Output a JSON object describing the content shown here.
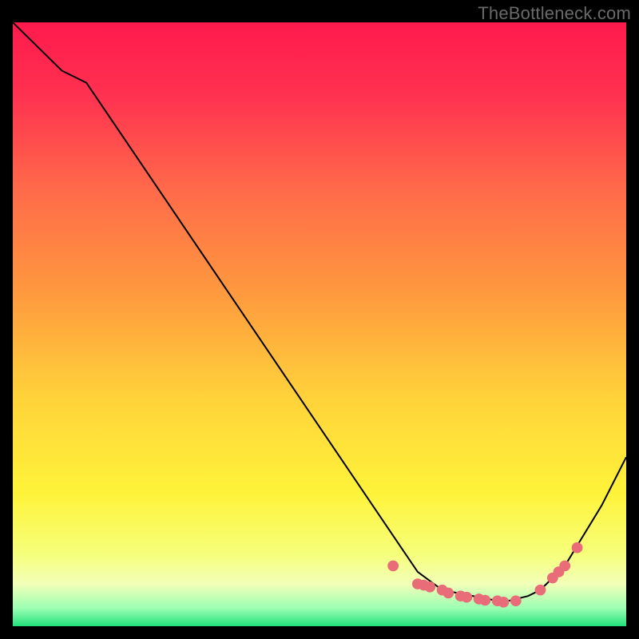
{
  "watermark": "TheBottleneck.com",
  "chart_data": {
    "type": "line",
    "title": "",
    "xlabel": "",
    "ylabel": "",
    "xlim": [
      0,
      100
    ],
    "ylim": [
      0,
      100
    ],
    "grid": false,
    "series": [
      {
        "name": "curve",
        "x": [
          0,
          8,
          12,
          60,
          64,
          66,
          70,
          80,
          84,
          86,
          90,
          96,
          100
        ],
        "y": [
          100,
          92,
          90,
          18,
          12,
          9,
          6,
          4,
          5,
          6,
          10,
          20,
          28
        ]
      }
    ],
    "markers": {
      "name": "points",
      "x": [
        62,
        66,
        67,
        68,
        70,
        71,
        73,
        74,
        76,
        77,
        79,
        80,
        82,
        86,
        88,
        89,
        90,
        92
      ],
      "y": [
        10,
        7,
        6.8,
        6.5,
        6,
        5.5,
        5,
        4.8,
        4.5,
        4.3,
        4.2,
        4,
        4.2,
        6,
        8,
        9,
        10,
        13
      ]
    },
    "gradient_stops": [
      {
        "offset": 0.0,
        "color": "#ff1a4d"
      },
      {
        "offset": 0.12,
        "color": "#ff3150"
      },
      {
        "offset": 0.28,
        "color": "#ff6b4a"
      },
      {
        "offset": 0.45,
        "color": "#ff9a3e"
      },
      {
        "offset": 0.62,
        "color": "#ffd23a"
      },
      {
        "offset": 0.78,
        "color": "#fff33a"
      },
      {
        "offset": 0.88,
        "color": "#f6ff7a"
      },
      {
        "offset": 0.93,
        "color": "#f2ffb8"
      },
      {
        "offset": 0.97,
        "color": "#9cffb3"
      },
      {
        "offset": 1.0,
        "color": "#21e07a"
      }
    ],
    "marker_color": "#e86d78",
    "line_color": "#000000"
  }
}
